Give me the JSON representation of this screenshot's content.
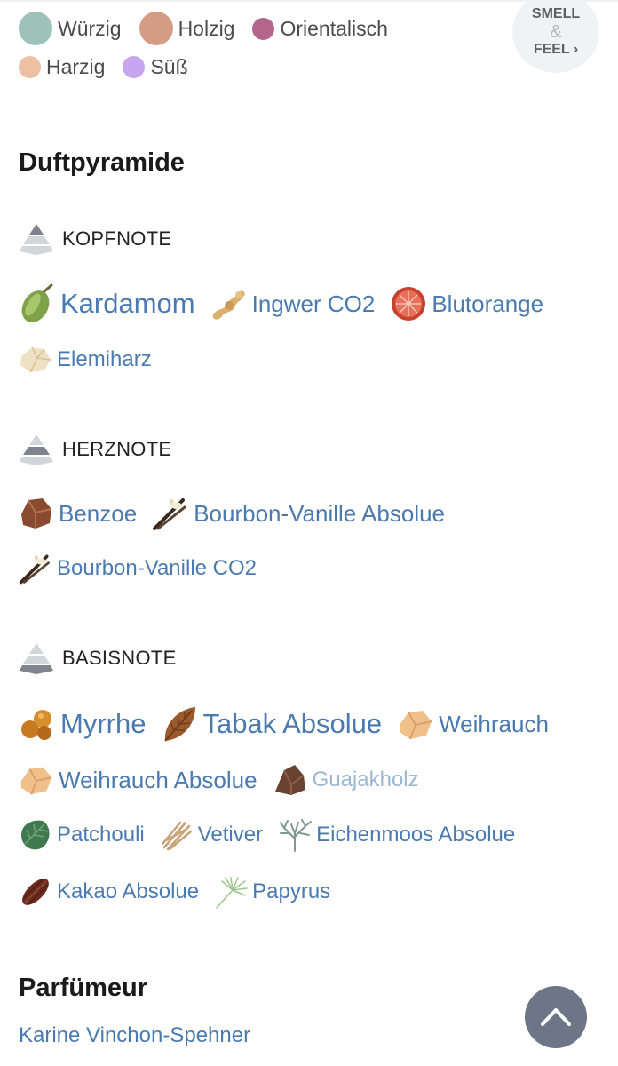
{
  "legend": [
    {
      "label": "Würzig",
      "color": "#9ec2b8",
      "size": "l"
    },
    {
      "label": "Holzig",
      "color": "#d49b85",
      "size": "l"
    },
    {
      "label": "Orientalisch",
      "color": "#b5648c",
      "size": "m"
    },
    {
      "label": "Harzig",
      "color": "#ebc0a3",
      "size": "m"
    },
    {
      "label": "Süß",
      "color": "#c7a5ef",
      "size": "m"
    }
  ],
  "smell_feel": {
    "line1": "SMELL",
    "amp": "&",
    "line2": "FEEL ›"
  },
  "sections": {
    "pyramid_title": "Duftpyramide",
    "perfumer_title": "Parfümeur"
  },
  "notes": {
    "top": {
      "label": "KOPFNOTE",
      "ingredients": [
        {
          "name": "Kardamom",
          "icon": "cardamom-icon"
        },
        {
          "name": "Ingwer CO2",
          "icon": "ginger-icon"
        },
        {
          "name": "Blutorange",
          "icon": "blood-orange-icon"
        },
        {
          "name": "Elemiharz",
          "icon": "elemi-resin-icon"
        }
      ]
    },
    "heart": {
      "label": "HERZNOTE",
      "ingredients": [
        {
          "name": "Benzoe",
          "icon": "benzoin-icon"
        },
        {
          "name": "Bourbon-Vanille Absolue",
          "icon": "vanilla-icon"
        },
        {
          "name": "Bourbon-Vanille CO2",
          "icon": "vanilla-icon"
        }
      ]
    },
    "base": {
      "label": "BASISNOTE",
      "ingredients": [
        {
          "name": "Myrrhe",
          "icon": "myrrh-icon"
        },
        {
          "name": "Tabak Absolue",
          "icon": "tobacco-leaf-icon"
        },
        {
          "name": "Weihrauch",
          "icon": "frankincense-icon"
        },
        {
          "name": "Weihrauch Absolue",
          "icon": "frankincense-icon"
        },
        {
          "name": "Guajakholz",
          "icon": "guaiac-wood-icon"
        },
        {
          "name": "Patchouli",
          "icon": "patchouli-leaf-icon"
        },
        {
          "name": "Vetiver",
          "icon": "vetiver-root-icon"
        },
        {
          "name": "Eichenmoos Absolue",
          "icon": "oakmoss-icon"
        },
        {
          "name": "Kakao Absolue",
          "icon": "cocoa-pod-icon"
        },
        {
          "name": "Papyrus",
          "icon": "papyrus-icon"
        }
      ]
    }
  },
  "perfumer": {
    "name": "Karine Vinchon-Spehner"
  },
  "colors": {
    "link": "#4a7ab0",
    "link_faded": "#9db7d3",
    "scroll_button": "#6c7686"
  }
}
